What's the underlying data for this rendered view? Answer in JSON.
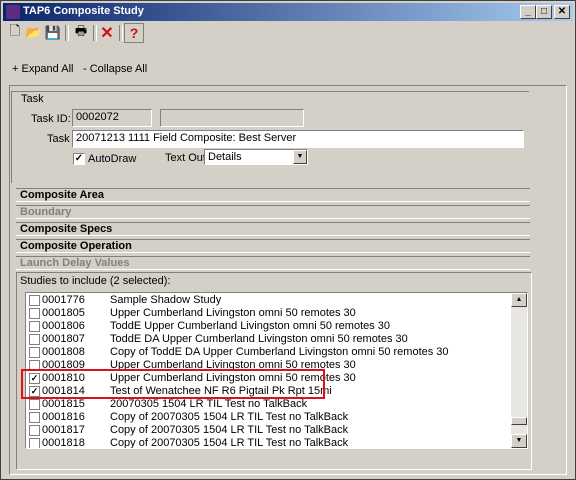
{
  "window": {
    "title": "TAP6 Composite Study",
    "min": "_",
    "max": "□",
    "close": "✕"
  },
  "toolbar": {
    "new": "🗋",
    "open": "📂",
    "save": "💾",
    "print": "🖶",
    "delete": "✕",
    "help": "?"
  },
  "expand_all": "+ Expand All",
  "collapse_all": "- Collapse All",
  "task": {
    "heading": "Task",
    "id_label": "Task ID:",
    "id_value": "0002072",
    "extra_value": "",
    "task_label": "Task",
    "task_value": "20071213 1111 Field Composite: Best Server",
    "autodraw_label": "AutoDraw",
    "autodraw_checked": "✓",
    "textout_label": "Text Out:",
    "textout_value": "Details"
  },
  "sections": {
    "composite_area": "Composite Area",
    "boundary": "Boundary",
    "composite_specs": "Composite Specs",
    "composite_operation": "Composite Operation",
    "launch_delay": "Launch Delay Values"
  },
  "studies": {
    "label": "Studies to include (2 selected):",
    "rows": [
      {
        "id": "0001776",
        "name": "Sample Shadow Study",
        "check": ""
      },
      {
        "id": "0001805",
        "name": "Upper Cumberland Livingston omni 50 remotes 30",
        "check": ""
      },
      {
        "id": "0001806",
        "name": "ToddE Upper Cumberland Livingston omni 50 remotes 30",
        "check": ""
      },
      {
        "id": "0001807",
        "name": "ToddE DA Upper Cumberland Livingston omni 50 remotes 30",
        "check": ""
      },
      {
        "id": "0001808",
        "name": "Copy of ToddE DA Upper Cumberland Livingston omni 50 remotes 30",
        "check": ""
      },
      {
        "id": "0001809",
        "name": "Upper Cumberland Livingston omni 50 remotes 30",
        "check": ""
      },
      {
        "id": "0001810",
        "name": "Upper Cumberland Livingston omni 50 remotes 30",
        "check": "✓"
      },
      {
        "id": "0001814",
        "name": "Test of Wenatchee NF R6 Pigtail Pk Rpt 15mi",
        "check": "✓"
      },
      {
        "id": "0001815",
        "name": "20070305 1504 LR TIL Test no TalkBack",
        "check": ""
      },
      {
        "id": "0001816",
        "name": "Copy of 20070305 1504 LR TIL Test no TalkBack",
        "check": ""
      },
      {
        "id": "0001817",
        "name": "Copy of 20070305 1504 LR TIL Test no TalkBack",
        "check": ""
      },
      {
        "id": "0001818",
        "name": "Copy of 20070305 1504 LR TIL Test no TalkBack",
        "check": ""
      }
    ]
  }
}
